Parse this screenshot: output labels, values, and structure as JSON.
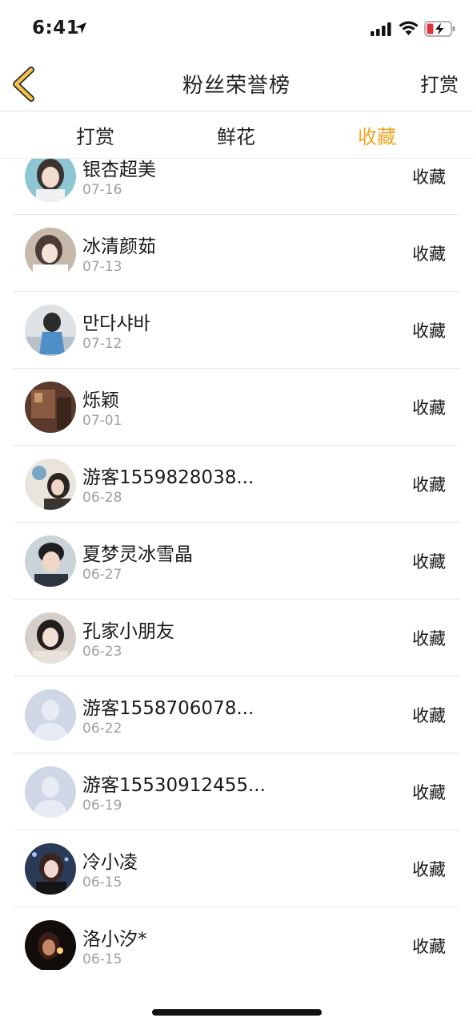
{
  "status_bar": {
    "time": "6:41"
  },
  "nav": {
    "title": "粉丝荣誉榜",
    "right_label": "打赏"
  },
  "tabs": [
    {
      "label": "打赏",
      "active": false
    },
    {
      "label": "鲜花",
      "active": false
    },
    {
      "label": "收藏",
      "active": true
    }
  ],
  "colors": {
    "accent": "#f0a522",
    "back_icon": "#f2c14a",
    "date_text": "#a0a0a0"
  },
  "list": [
    {
      "name": "银杏超美",
      "date": "07-16",
      "action": "收藏",
      "avatar": "photo"
    },
    {
      "name": "冰清颜茹",
      "date": "07-13",
      "action": "收藏",
      "avatar": "photo"
    },
    {
      "name": "만다샤바",
      "date": "07-12",
      "action": "收藏",
      "avatar": "photo"
    },
    {
      "name": "烁颖",
      "date": "07-01",
      "action": "收藏",
      "avatar": "photo"
    },
    {
      "name": "游客1559828038...",
      "date": "06-28",
      "action": "收藏",
      "avatar": "photo"
    },
    {
      "name": "夏梦灵冰雪晶",
      "date": "06-27",
      "action": "收藏",
      "avatar": "photo"
    },
    {
      "name": "孔家小朋友",
      "date": "06-23",
      "action": "收藏",
      "avatar": "photo"
    },
    {
      "name": "游客1558706078...",
      "date": "06-22",
      "action": "收藏",
      "avatar": "default"
    },
    {
      "name": "游客15530912455...",
      "date": "06-19",
      "action": "收藏",
      "avatar": "default"
    },
    {
      "name": "冷小凌",
      "date": "06-15",
      "action": "收藏",
      "avatar": "photo"
    },
    {
      "name": "洛小汐*",
      "date": "06-15",
      "action": "收藏",
      "avatar": "photo"
    }
  ]
}
